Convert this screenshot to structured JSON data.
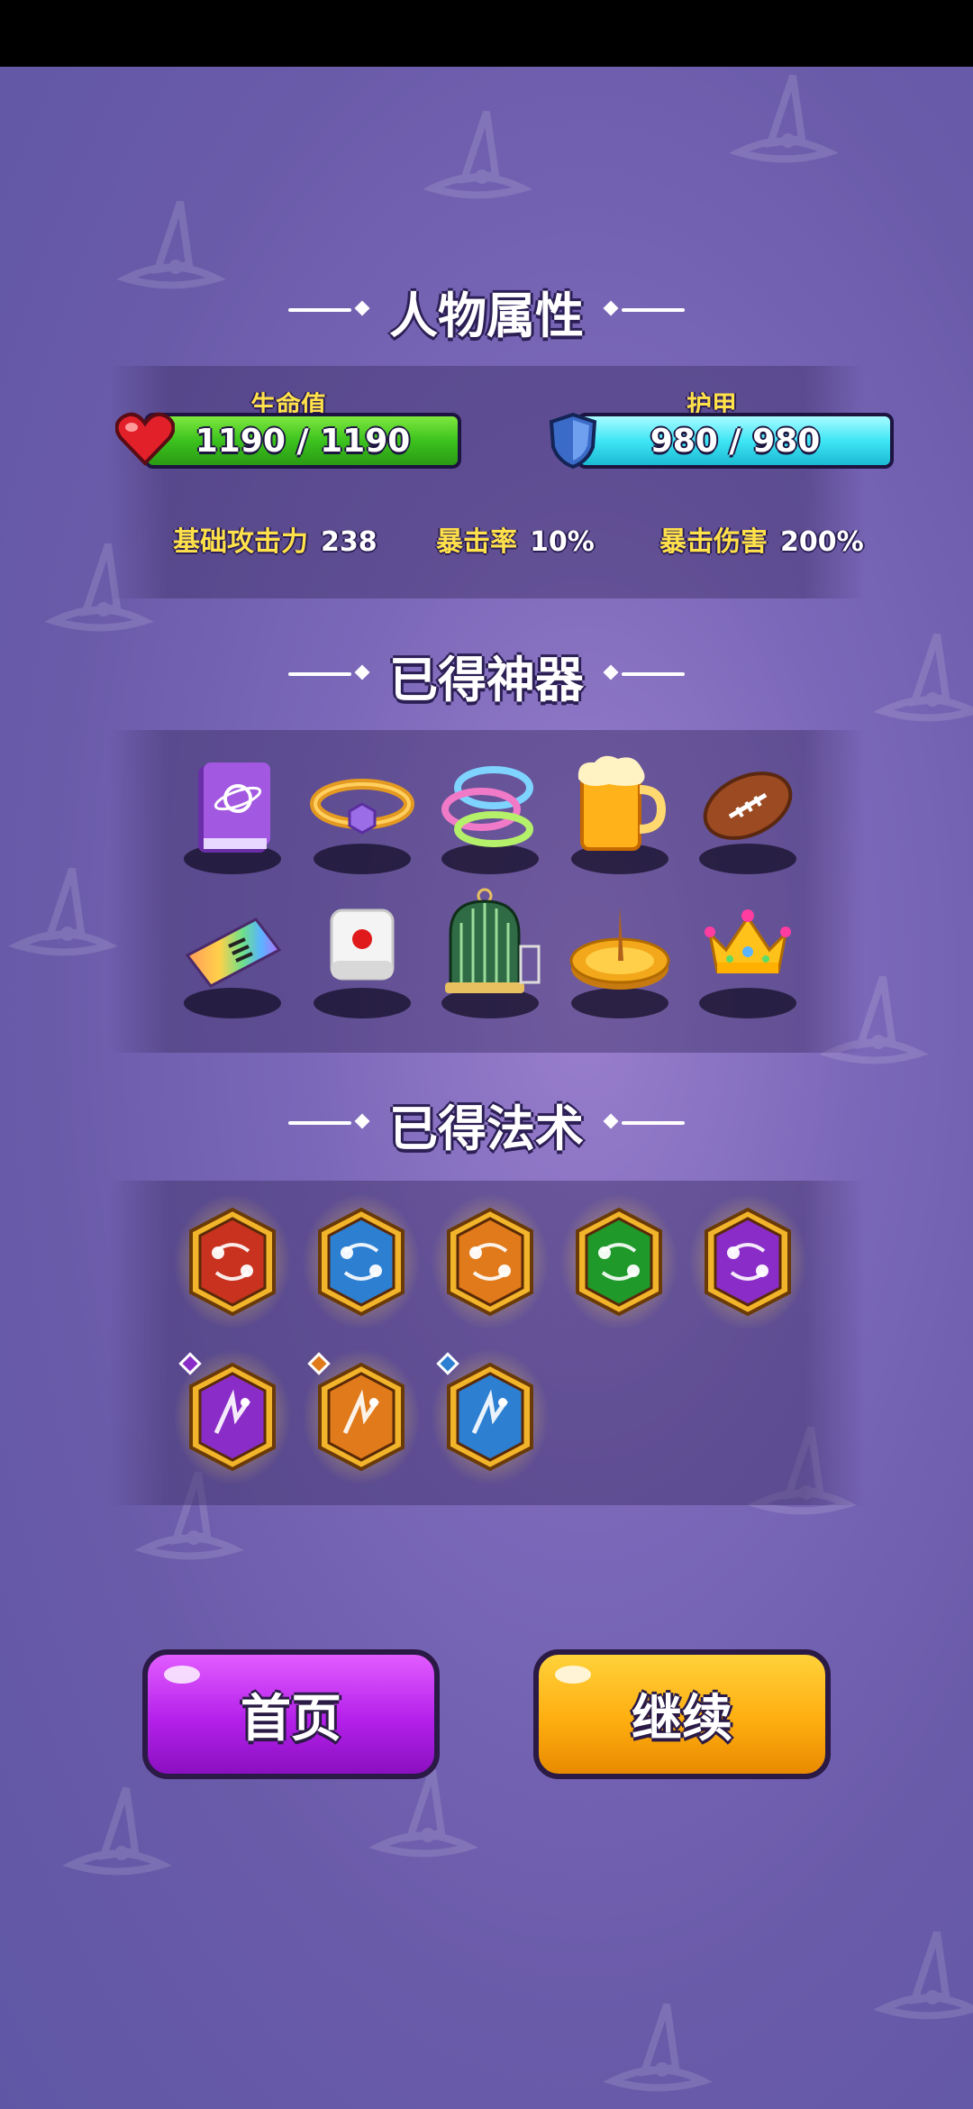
{
  "sections": {
    "attributes_title": "人物属性",
    "artifacts_title": "已得神器",
    "spells_title": "已得法术"
  },
  "hp": {
    "label": "生命值",
    "value": "1190 / 1190",
    "fill_fraction": 1.0,
    "color": "#3cc21e"
  },
  "armor": {
    "label": "护甲",
    "value": "980 / 980",
    "fill_fraction": 1.0,
    "color": "#3fe6f5"
  },
  "stats": [
    {
      "label": "基础攻击力",
      "value": "238"
    },
    {
      "label": "暴击率",
      "value": "10%"
    },
    {
      "label": "暴击伤害",
      "value": "200%"
    }
  ],
  "artifacts": [
    {
      "icon": "purple-book-icon"
    },
    {
      "icon": "gold-bracelet-icon"
    },
    {
      "icon": "rainbow-rings-icon"
    },
    {
      "icon": "beer-mug-icon"
    },
    {
      "icon": "football-icon"
    },
    {
      "icon": "rainbow-ticket-icon"
    },
    {
      "icon": "dice-icon"
    },
    {
      "icon": "birdcage-icon"
    },
    {
      "icon": "sundial-icon"
    },
    {
      "icon": "crown-icon"
    }
  ],
  "spells": [
    {
      "icon": "red-orb-spell-icon",
      "color": "#c8321e"
    },
    {
      "icon": "blue-orb-spell-icon",
      "color": "#2c7fd1"
    },
    {
      "icon": "orange-orb-spell-icon",
      "color": "#e07a1a"
    },
    {
      "icon": "green-orb-spell-icon",
      "color": "#1f9a2a"
    },
    {
      "icon": "purple-orb-spell-icon",
      "color": "#8a2cc8"
    },
    {
      "icon": "purple-sparks-spell-icon",
      "color": "#8a2cc8"
    },
    {
      "icon": "lightning-spell-icon",
      "color": "#e07a1a"
    },
    {
      "icon": "ice-shards-spell-icon",
      "color": "#2c7fd1"
    }
  ],
  "buttons": {
    "home": "首页",
    "continue": "继续"
  }
}
